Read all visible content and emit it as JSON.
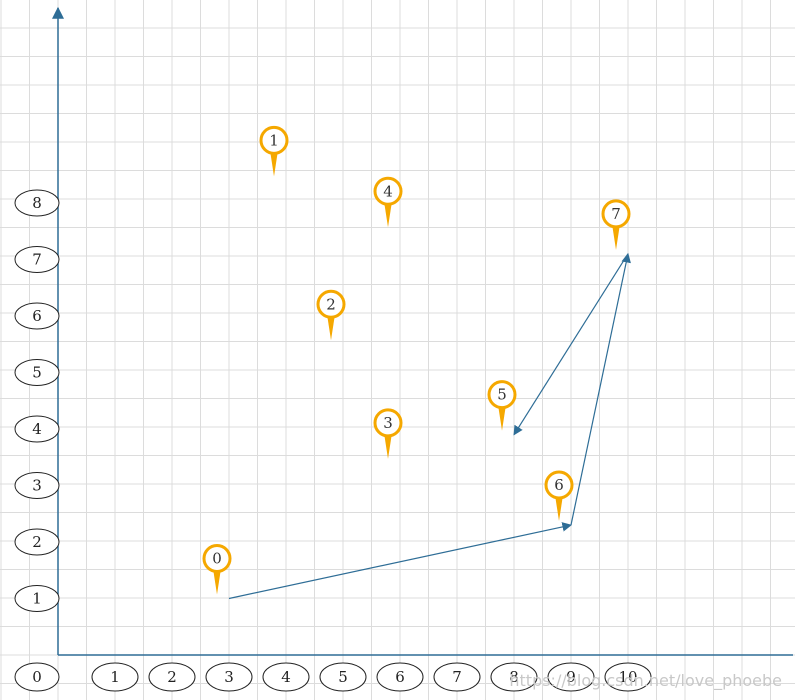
{
  "diagram": {
    "x_axis_labels": [
      "1",
      "2",
      "3",
      "4",
      "5",
      "6",
      "7",
      "8",
      "9",
      "10"
    ],
    "y_axis_labels": [
      "1",
      "2",
      "3",
      "4",
      "5",
      "6",
      "7",
      "8"
    ],
    "origin_label": "0",
    "points": [
      {
        "id": "0",
        "x": 3,
        "y": 1
      },
      {
        "id": "1",
        "x": 4,
        "y": 8.4
      },
      {
        "id": "2",
        "x": 5,
        "y": 5.5
      },
      {
        "id": "3",
        "x": 6,
        "y": 3.4
      },
      {
        "id": "4",
        "x": 6,
        "y": 7.5
      },
      {
        "id": "5",
        "x": 8,
        "y": 3.9
      },
      {
        "id": "6",
        "x": 9,
        "y": 2.3
      },
      {
        "id": "7",
        "x": 10,
        "y": 7.1
      }
    ],
    "path": [
      "0",
      "6",
      "7",
      "5"
    ],
    "watermark": "https://blog.csdn.net/love_phoebe",
    "colors": {
      "axis": "#2e6d96",
      "arrow": "#2e6d96",
      "pin": "#f5a800",
      "grid": "#dcdcdc"
    }
  }
}
